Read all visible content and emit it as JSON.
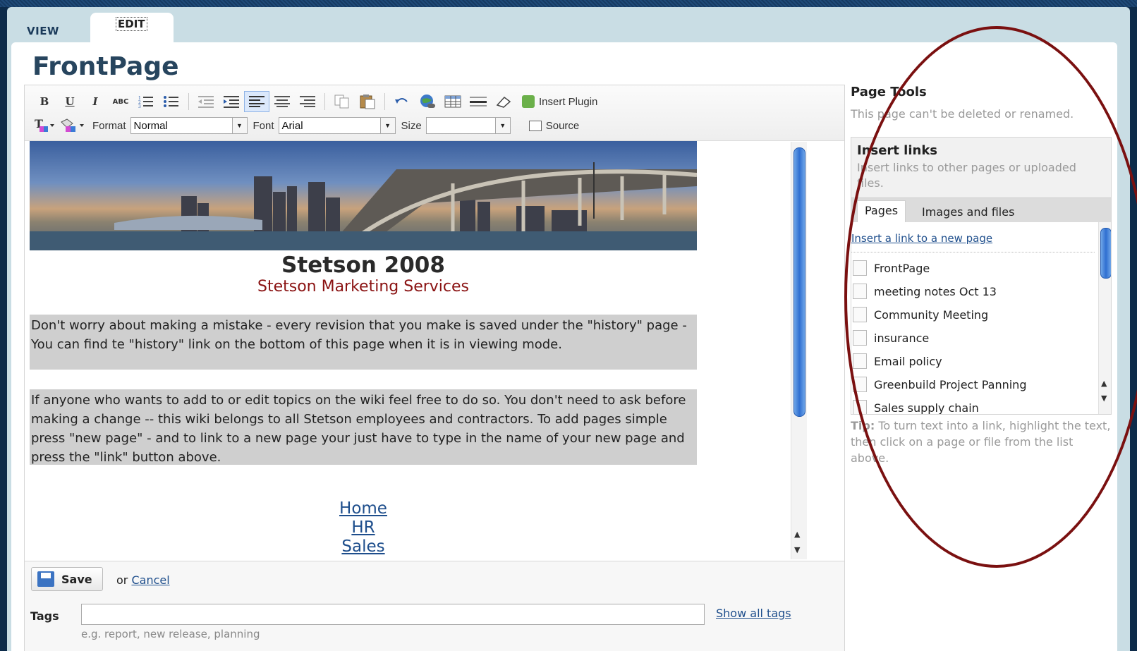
{
  "tabs": {
    "view": "VIEW",
    "edit": "EDIT"
  },
  "page_title": "FrontPage",
  "toolbar": {
    "bold": "B",
    "underline": "U",
    "italic": "I",
    "strike": "ABC",
    "insert_plugin": "Insert Plugin",
    "text_color": "T",
    "format_label": "Format",
    "format_value": "Normal",
    "font_label": "Font",
    "font_value": "Arial",
    "size_label": "Size",
    "size_value": "",
    "source": "Source"
  },
  "content": {
    "heading": "Stetson 2008",
    "subheading": "Stetson Marketing Services",
    "para1": "Don't worry about making a mistake - every revision that you make is saved under the \"history\" page - You can find te \"history\" link on the bottom of this page when it is in viewing mode.",
    "para2": "If anyone who wants to add to or edit topics on the wiki feel free to do so. You don't need to ask before making a change -- this wiki belongs to all Stetson employees and contractors. To add pages simple press \"new page\" - and to link to a new page your just have to type in the name of your new page and press the \"link\" button above.",
    "links": [
      "Home",
      "HR",
      "Sales"
    ]
  },
  "footer": {
    "save": "Save",
    "or": "or",
    "cancel": "Cancel",
    "tags_label": "Tags",
    "tags_value": "",
    "tags_hint": "e.g. report, new release, planning",
    "show_all_tags": "Show all tags"
  },
  "sidebar": {
    "page_tools": "Page Tools",
    "page_tools_note": "This page can't be deleted or renamed.",
    "insert_links_title": "Insert links",
    "insert_links_desc": "Insert links to other pages or uploaded files.",
    "tab_pages": "Pages",
    "tab_images": "Images and files",
    "new_page_link": "Insert a link to a new page",
    "pages": [
      "FrontPage",
      "meeting notes Oct 13",
      "Community Meeting",
      "insurance",
      "Email policy",
      "Greenbuild Project Panning",
      "Sales supply chain"
    ],
    "tip_label": "Tip:",
    "tip_text": "To turn text into a link, highlight the text, then click on a page or file from the list above."
  },
  "colors": {
    "title": "#27455e",
    "subheading": "#8a1212",
    "link": "#1e4e8c",
    "annotation_ellipse": "#7a1010"
  }
}
